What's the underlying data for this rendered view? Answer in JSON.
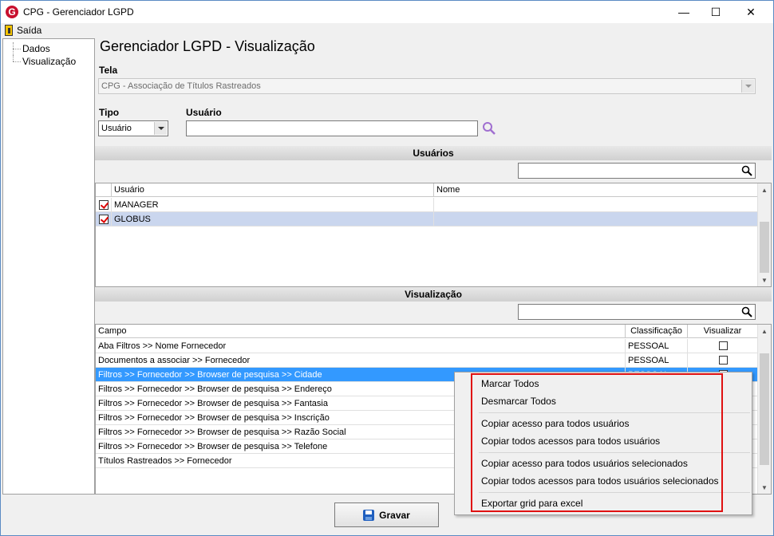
{
  "window": {
    "title": "CPG - Gerenciador LGPD",
    "app_icon_letter": "G",
    "controls": {
      "minimize": "—",
      "maximize": "☐",
      "close": "✕"
    }
  },
  "menu": {
    "exit_label": "Saída"
  },
  "tree": {
    "items": [
      "Dados",
      "Visualização"
    ]
  },
  "page": {
    "title": "Gerenciador LGPD - Visualização"
  },
  "tela": {
    "label": "Tela",
    "value": "CPG - Associação de Títulos Rastreados"
  },
  "tipo": {
    "label": "Tipo",
    "value": "Usuário"
  },
  "usuario_field": {
    "label": "Usuário",
    "value": ""
  },
  "usuarios_section": {
    "header": "Usuários",
    "columns": [
      "Usuário",
      "Nome"
    ],
    "rows": [
      {
        "usuario": "MANAGER",
        "nome": "",
        "checked": true
      },
      {
        "usuario": "GLOBUS",
        "nome": "",
        "checked": true
      }
    ]
  },
  "visualizacao_section": {
    "header": "Visualização",
    "columns": [
      "Campo",
      "Classificação",
      "Visualizar"
    ],
    "rows": [
      {
        "campo": "Aba Filtros >> Nome Fornecedor",
        "classificacao": "PESSOAL",
        "visualizar": false
      },
      {
        "campo": "Documentos a associar >> Fornecedor",
        "classificacao": "PESSOAL",
        "visualizar": false
      },
      {
        "campo": "Filtros >> Fornecedor >> Browser de pesquisa >> Cidade",
        "classificacao": "PESSOAL",
        "visualizar": false
      },
      {
        "campo": "Filtros >> Fornecedor >> Browser de pesquisa >> Endereço",
        "classificacao": "",
        "visualizar": false
      },
      {
        "campo": "Filtros >> Fornecedor >> Browser de pesquisa >> Fantasia",
        "classificacao": "",
        "visualizar": false
      },
      {
        "campo": "Filtros >> Fornecedor >> Browser de pesquisa >> Inscrição",
        "classificacao": "",
        "visualizar": false
      },
      {
        "campo": "Filtros >> Fornecedor >> Browser de pesquisa >> Razão Social",
        "classificacao": "",
        "visualizar": false
      },
      {
        "campo": "Filtros >> Fornecedor >> Browser de pesquisa >> Telefone",
        "classificacao": "",
        "visualizar": false
      },
      {
        "campo": "Títulos Rastreados >> Fornecedor",
        "classificacao": "",
        "visualizar": false
      }
    ]
  },
  "footer": {
    "save_label": "Gravar"
  },
  "context_menu": {
    "items": [
      "Marcar Todos",
      "Desmarcar Todos",
      "Copiar acesso para todos usuários",
      "Copiar todos acessos para todos usuários",
      "Copiar acesso para todos usuários selecionados",
      "Copiar todos acessos para todos usuários selecionados",
      "Exportar grid para excel"
    ]
  },
  "colors": {
    "highlight_border": "#e01010",
    "selection": "#3399ff",
    "selection_inactive": "#cad6ee",
    "app_icon": "#c8102e",
    "search_icon": "#a06fd0"
  }
}
